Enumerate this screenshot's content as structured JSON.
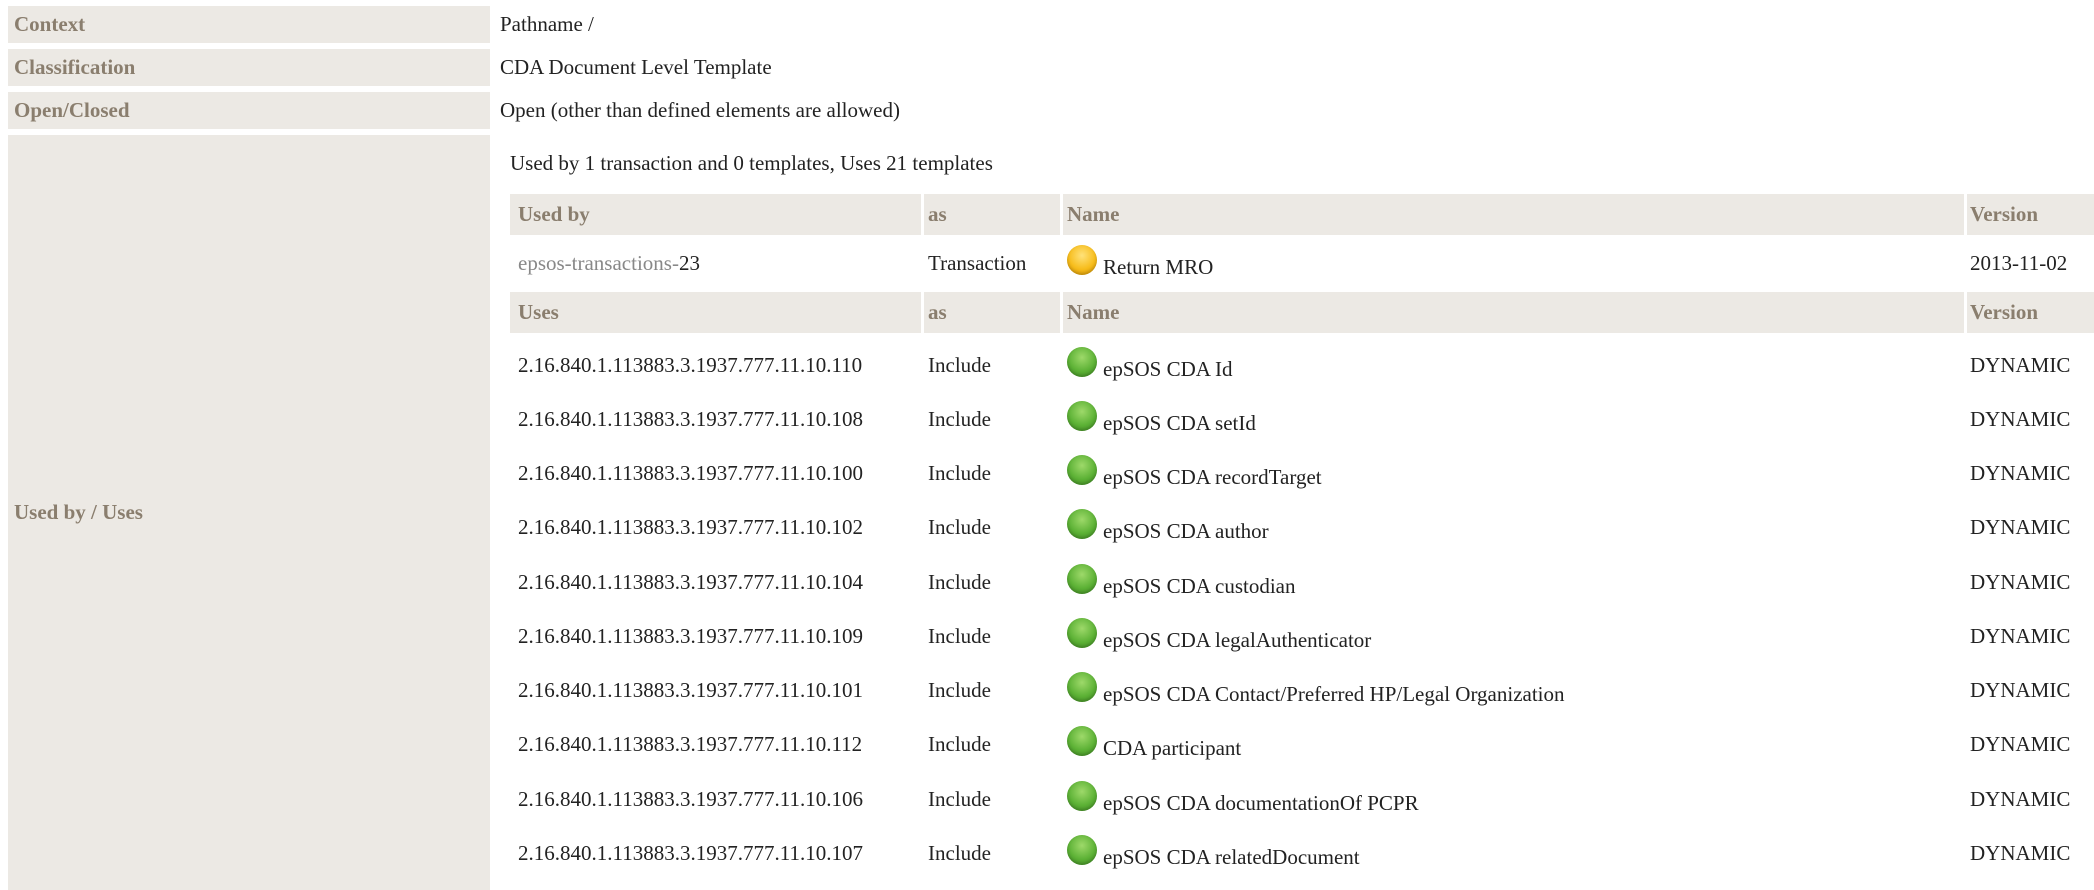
{
  "properties": [
    {
      "label": "Context",
      "value": "Pathname /"
    },
    {
      "label": "Classification",
      "value": "CDA Document Level Template"
    },
    {
      "label": "Open/Closed",
      "value": "Open (other than defined elements are allowed)"
    }
  ],
  "usage": {
    "label": "Used by / Uses",
    "summary": "Used by 1 transaction and 0 templates, Uses 21 templates",
    "used_by_headers": [
      "Used by",
      "as",
      "Name",
      "Version"
    ],
    "used_by": [
      {
        "id_prefix": "epsos-transactions-",
        "id_suffix": "23",
        "as": "Transaction",
        "status": "yellow",
        "name": "Return MRO",
        "version": "2013-11-02"
      }
    ],
    "uses_headers": [
      "Uses",
      "as",
      "Name",
      "Version"
    ],
    "uses": [
      {
        "id": "2.16.840.1.113883.3.1937.777.11.10.110",
        "as": "Include",
        "status": "green",
        "name": "epSOS CDA Id",
        "version": "DYNAMIC"
      },
      {
        "id": "2.16.840.1.113883.3.1937.777.11.10.108",
        "as": "Include",
        "status": "green",
        "name": "epSOS CDA setId",
        "version": "DYNAMIC"
      },
      {
        "id": "2.16.840.1.113883.3.1937.777.11.10.100",
        "as": "Include",
        "status": "green",
        "name": "epSOS CDA recordTarget",
        "version": "DYNAMIC"
      },
      {
        "id": "2.16.840.1.113883.3.1937.777.11.10.102",
        "as": "Include",
        "status": "green",
        "name": "epSOS CDA author",
        "version": "DYNAMIC"
      },
      {
        "id": "2.16.840.1.113883.3.1937.777.11.10.104",
        "as": "Include",
        "status": "green",
        "name": "epSOS CDA custodian",
        "version": "DYNAMIC"
      },
      {
        "id": "2.16.840.1.113883.3.1937.777.11.10.109",
        "as": "Include",
        "status": "green",
        "name": "epSOS CDA legalAuthenticator",
        "version": "DYNAMIC"
      },
      {
        "id": "2.16.840.1.113883.3.1937.777.11.10.101",
        "as": "Include",
        "status": "green",
        "name": "epSOS CDA Contact/Preferred HP/Legal Organization",
        "version": "DYNAMIC"
      },
      {
        "id": "2.16.840.1.113883.3.1937.777.11.10.112",
        "as": "Include",
        "status": "green",
        "name": "CDA participant",
        "version": "DYNAMIC"
      },
      {
        "id": "2.16.840.1.113883.3.1937.777.11.10.106",
        "as": "Include",
        "status": "green",
        "name": "epSOS CDA documentationOf PCPR",
        "version": "DYNAMIC"
      },
      {
        "id": "2.16.840.1.113883.3.1937.777.11.10.107",
        "as": "Include",
        "status": "green",
        "name": "epSOS CDA relatedDocument",
        "version": "DYNAMIC"
      }
    ]
  }
}
